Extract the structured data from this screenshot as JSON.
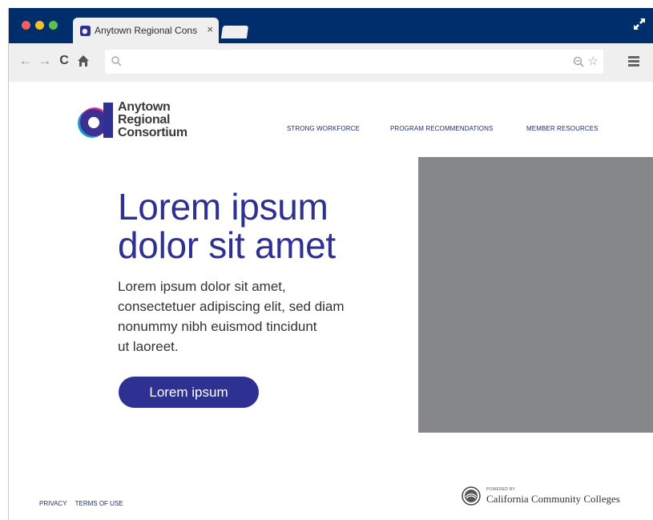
{
  "browser": {
    "tab_title": "Anytown Regional Cons",
    "tab_close": "×",
    "url": ""
  },
  "site": {
    "brand_line1": "Anytown",
    "brand_line2": "Regional",
    "brand_line3": "Consortium",
    "nav": [
      "STRONG WORKFORCE",
      "PROGRAM RECOMMENDATIONS",
      "MEMBER RESOURCES"
    ],
    "headline_line1": "Lorem ipsum",
    "headline_line2": "dolor sit amet",
    "body_line1": "Lorem ipsum dolor sit amet,",
    "body_line2": "consectetuer adipiscing elit, sed diam",
    "body_line3": "nonummy nibh euismod tincidunt",
    "body_line4": "ut laoreet.",
    "cta_label": "Lorem ipsum",
    "footer_links": [
      "PRIVACY",
      "TERMS OF USE"
    ],
    "powered_by": "POWERED BY",
    "ccc_name": "California Community Colleges"
  },
  "colors": {
    "titlebar": "#002e6d",
    "accent": "#2e3192",
    "gray_block": "#86878b"
  }
}
